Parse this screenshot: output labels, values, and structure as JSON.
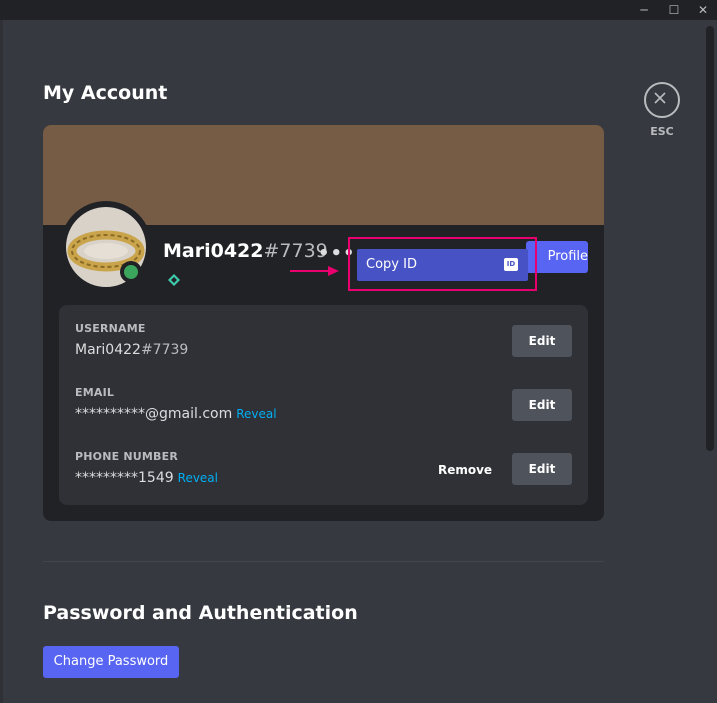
{
  "window": {
    "minimize_label": "─",
    "maximize_label": "☐",
    "close_label": "✕"
  },
  "page": {
    "title": "My Account"
  },
  "esc": {
    "label": "ESC"
  },
  "profile": {
    "username": "Mari0422",
    "discriminator": "#7739",
    "more_label": "•••",
    "edit_profile_label": "Profile",
    "status_color": "#3ba55d",
    "banner_color": "#765c45"
  },
  "context_menu": {
    "copy_id_label": "Copy ID",
    "id_icon": "ID"
  },
  "account": {
    "username": {
      "label": "USERNAME",
      "name": "Mari0422",
      "tag": "#7739",
      "edit_label": "Edit"
    },
    "email": {
      "label": "EMAIL",
      "value": "**********@gmail.com",
      "reveal_label": "Reveal",
      "edit_label": "Edit"
    },
    "phone": {
      "label": "PHONE NUMBER",
      "value": "*********1549",
      "reveal_label": "Reveal",
      "remove_label": "Remove",
      "edit_label": "Edit"
    }
  },
  "security": {
    "title": "Password and Authentication",
    "change_password_label": "Change Password"
  },
  "colors": {
    "accent": "#5865f2",
    "highlight": "#e8006f",
    "link": "#00aff4"
  }
}
